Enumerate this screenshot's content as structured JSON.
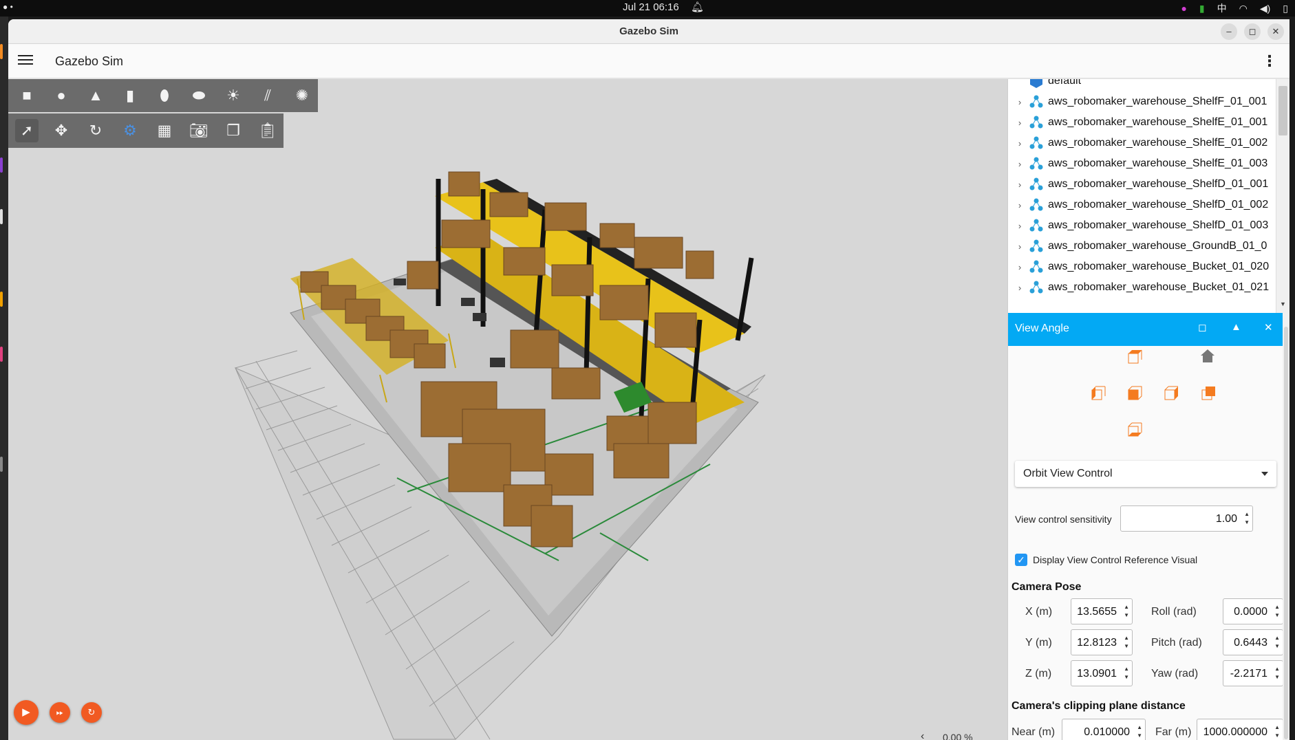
{
  "system": {
    "clock": "Jul 21  06:16",
    "input_method": "中"
  },
  "window": {
    "title": "Gazebo Sim"
  },
  "appbar": {
    "app_name": "Gazebo Sim"
  },
  "toolbar_shapes": [
    "box-icon",
    "sphere-icon",
    "cone-icon",
    "cylinder-icon",
    "capsule-icon",
    "ellipsoid-icon",
    "sun-light-icon",
    "directional-light-icon",
    "spot-light-icon"
  ],
  "toolbar_tools": [
    "select-arrow-icon",
    "translate-icon",
    "rotate-icon",
    "transform-icon",
    "grid-icon",
    "screenshot-icon",
    "copy-icon",
    "paste-icon"
  ],
  "entity_tree": {
    "items": [
      {
        "label": "default",
        "expandable": false
      },
      {
        "label": "aws_robomaker_warehouse_ShelfF_01_001",
        "expandable": true
      },
      {
        "label": "aws_robomaker_warehouse_ShelfE_01_001",
        "expandable": true
      },
      {
        "label": "aws_robomaker_warehouse_ShelfE_01_002",
        "expandable": true
      },
      {
        "label": "aws_robomaker_warehouse_ShelfE_01_003",
        "expandable": true
      },
      {
        "label": "aws_robomaker_warehouse_ShelfD_01_001",
        "expandable": true
      },
      {
        "label": "aws_robomaker_warehouse_ShelfD_01_002",
        "expandable": true
      },
      {
        "label": "aws_robomaker_warehouse_ShelfD_01_003",
        "expandable": true
      },
      {
        "label": "aws_robomaker_warehouse_GroundB_01_0",
        "expandable": true
      },
      {
        "label": "aws_robomaker_warehouse_Bucket_01_020",
        "expandable": true
      },
      {
        "label": "aws_robomaker_warehouse_Bucket_01_021",
        "expandable": true
      }
    ]
  },
  "view_angle": {
    "title": "View Angle",
    "control_mode": "Orbit View Control",
    "sensitivity_label": "View control sensitivity",
    "sensitivity_value": "1.00",
    "reference_visual_label": "Display View Control Reference Visual",
    "reference_visual_checked": true,
    "camera_pose_title": "Camera Pose",
    "x_label": "X (m)",
    "x_value": "13.5655",
    "y_label": "Y (m)",
    "y_value": "12.8123",
    "z_label": "Z (m)",
    "z_value": "13.0901",
    "roll_label": "Roll (rad)",
    "roll_value": "0.0000",
    "pitch_label": "Pitch (rad)",
    "pitch_value": "0.6443",
    "yaw_label": "Yaw (rad)",
    "yaw_value": "-2.2171",
    "clipping_title": "Camera's clipping plane distance",
    "near_label": "Near (m)",
    "near_value": "0.010000",
    "far_label": "Far (m)",
    "far_value": "1000.000000"
  },
  "status": {
    "rtf": "0.00 %"
  },
  "colors": {
    "accent": "#03a9f4",
    "play": "#f15a22",
    "cube_orange": "#f47b20",
    "shelf_yellow": "#e8c21a",
    "box_brown": "#9c6d33"
  }
}
